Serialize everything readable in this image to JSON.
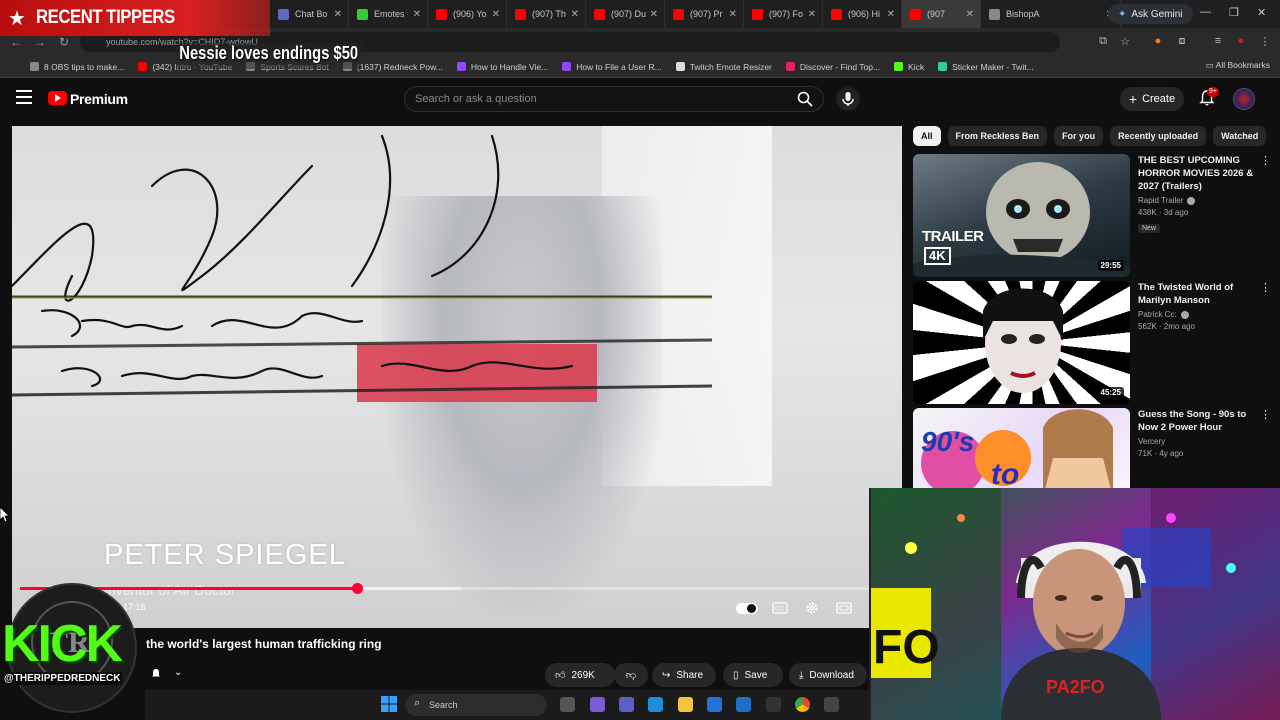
{
  "overlay": {
    "tippers_label": "RECENT TIPPERS",
    "tip_message": "Nessie loves endings $50"
  },
  "browser": {
    "tabs": [
      {
        "label": "Chat Bo",
        "color": "#5c6bc0"
      },
      {
        "label": "Emotes",
        "color": "#33cc33"
      },
      {
        "label": "(906) Yo",
        "color": "#ff0000"
      },
      {
        "label": "(907) Th",
        "color": "#ff0000"
      },
      {
        "label": "(907) Du",
        "color": "#ff0000"
      },
      {
        "label": "(907) Pr",
        "color": "#ff0000"
      },
      {
        "label": "(907) Fo",
        "color": "#ff0000"
      },
      {
        "label": "(906) Hi",
        "color": "#ff0000"
      },
      {
        "label": "(907",
        "color": "#ff0000"
      },
      {
        "label": "BishopA",
        "color": "#888888"
      }
    ],
    "ask_gemini": "Ask Gemini",
    "url": "youtube.com/watch?v=CHID7-wdowU",
    "bookmarks": [
      {
        "label": "8 OBS tips to make...",
        "color": "#888888"
      },
      {
        "label": "(342) Intro - YouTube",
        "color": "#ff0000"
      },
      {
        "label": "Sports Scores Bot",
        "color": "#888888"
      },
      {
        "label": "(1637) Redneck Pow...",
        "color": "#888888"
      },
      {
        "label": "How to Handle Vie...",
        "color": "#9146ff"
      },
      {
        "label": "How to File a User R...",
        "color": "#9146ff"
      },
      {
        "label": "Twitch Emote Resizer",
        "color": "#dddddd"
      },
      {
        "label": "Discover - Find Top...",
        "color": "#e91e63"
      },
      {
        "label": "Kick",
        "color": "#53fc18"
      },
      {
        "label": "Sticker Maker - Twit...",
        "color": "#33cc99"
      }
    ],
    "all_bookmarks": "All Bookmarks"
  },
  "youtube": {
    "brand": "Premium",
    "search_placeholder": "Search or ask a question",
    "create_label": "Create",
    "notification_count": "9+",
    "player": {
      "lower_third_name": "PETER SPIEGEL",
      "lower_third_title": "Inventor of Air Doctor",
      "time": "17:16",
      "progress": 0.39,
      "buffered": 0.51
    },
    "video_title": "the world's largest human trafficking ring",
    "actions": {
      "likes": "269K",
      "share": "Share",
      "save": "Save",
      "download": "Download"
    },
    "chips": [
      "All",
      "From Reckless Ben",
      "For you",
      "Recently uploaded",
      "Watched"
    ],
    "related": [
      {
        "title": "THE BEST UPCOMING HORROR MOVIES 2026 & 2027 (Trailers)",
        "channel": "Rapid Trailer",
        "meta": "438K · 3d ago",
        "duration": "29:55",
        "badge": "New",
        "thumb_text": "TRAILER",
        "thumb_text2": "4K"
      },
      {
        "title": "The Twisted World of Marilyn Manson",
        "channel": "Patrick Cc:",
        "meta": "562K · 2mo ago",
        "duration": "45:25",
        "badge": "",
        "thumb_text": "",
        "thumb_text2": ""
      },
      {
        "title": "Guess the Song - 90s to Now 2 Power Hour",
        "channel": "Vercery",
        "meta": "71K · 4y ago",
        "duration": "",
        "badge": "",
        "thumb_text": "90's",
        "thumb_text2": "to"
      }
    ]
  },
  "kick_overlay": {
    "logo_text": "KICK",
    "handle": "@THERIPPEDREDNECK"
  },
  "taskbar": {
    "search_label": "Search"
  }
}
